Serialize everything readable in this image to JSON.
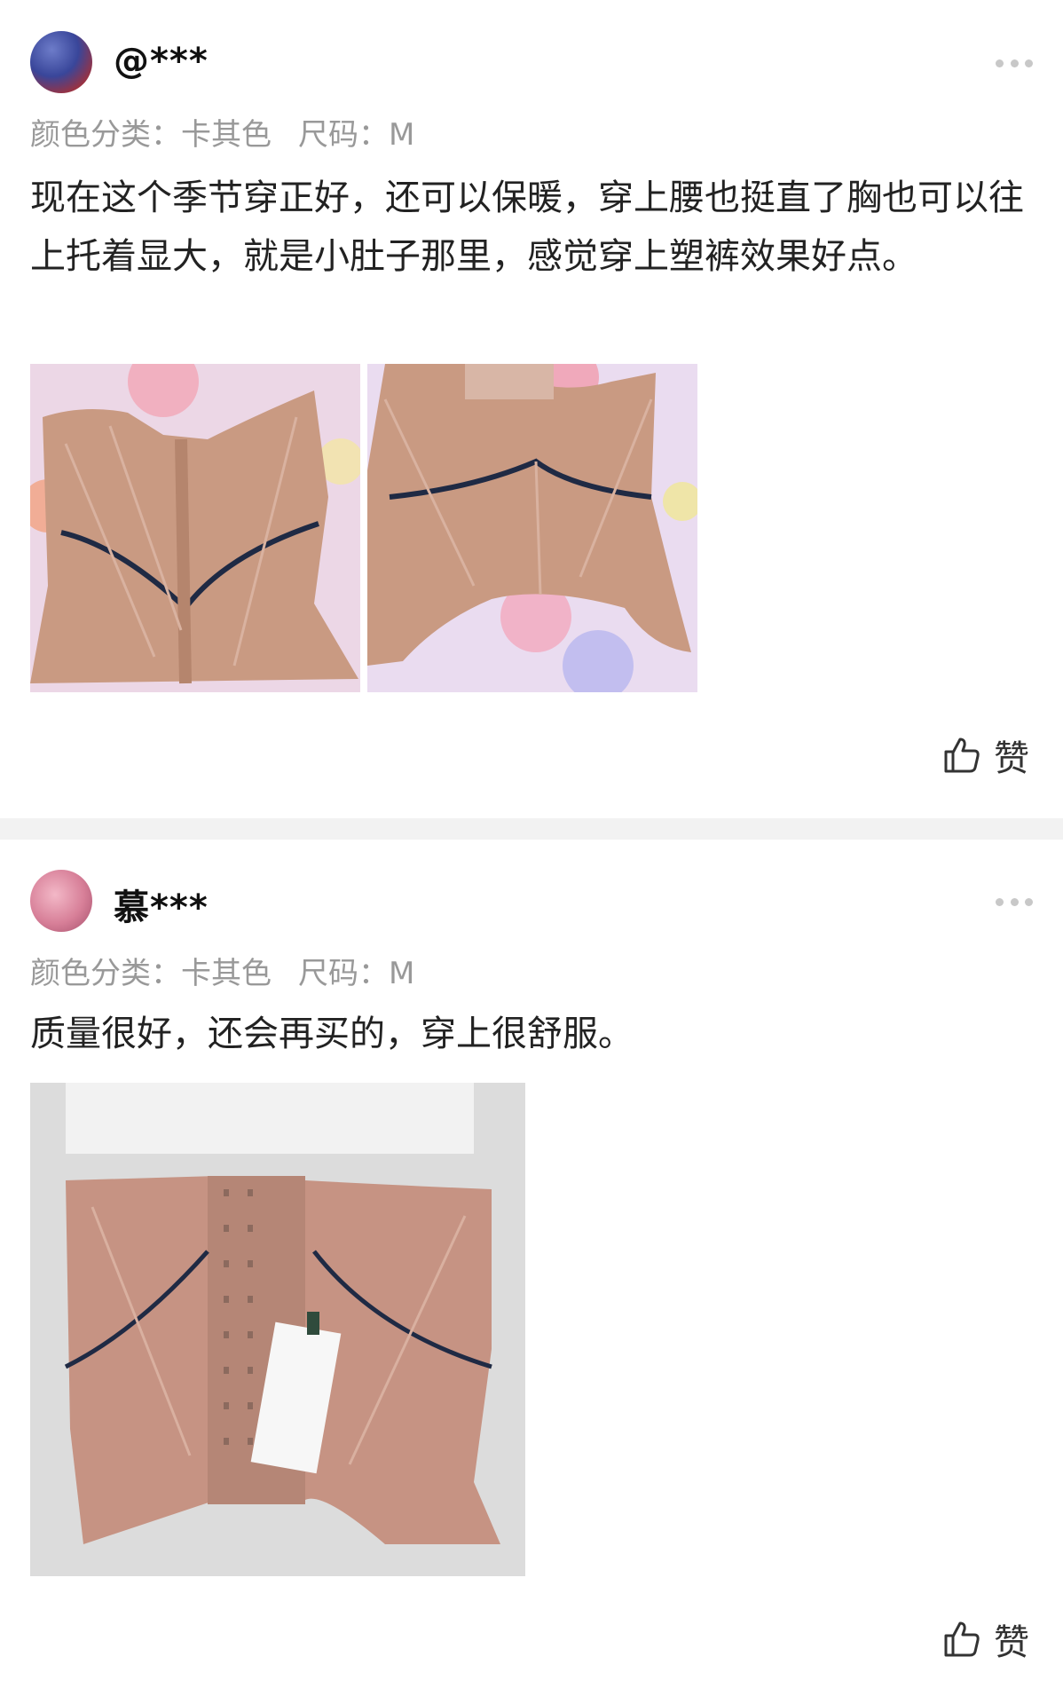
{
  "reviews": [
    {
      "username": "@***",
      "spec_color": "颜色分类：卡其色",
      "spec_size": "尺码：M",
      "content": "现在这个季节穿正好，还可以保暖，穿上腰也挺直了胸也可以往上托着显大，就是小肚子那里，感觉穿上塑裤效果好点。",
      "like_label": "赞"
    },
    {
      "username": "慕***",
      "spec_color": "颜色分类：卡其色",
      "spec_size": "尺码：M",
      "content": "质量很好，还会再买的，穿上很舒服。",
      "like_label": "赞"
    }
  ],
  "colors": {
    "secondary_text": "#999999",
    "corset_fabric": "#c99a82",
    "trim": "#1f2a44"
  }
}
